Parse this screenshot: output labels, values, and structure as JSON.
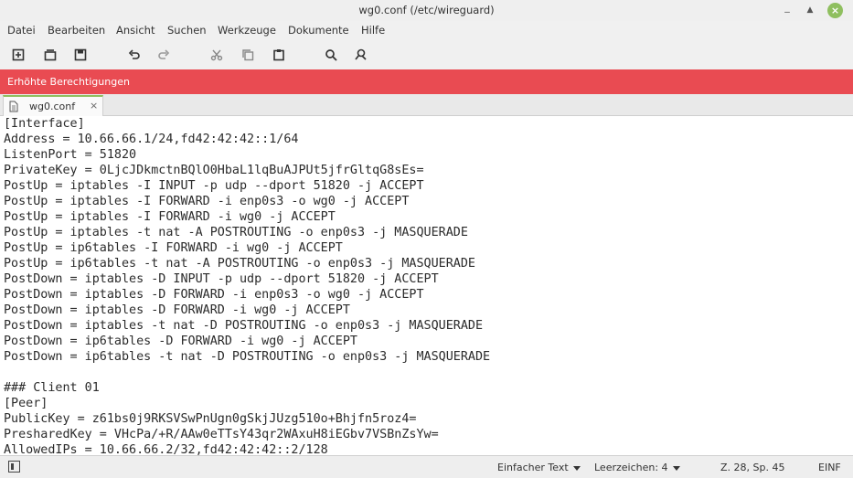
{
  "window": {
    "title": "wg0.conf (/etc/wireguard)"
  },
  "menu": {
    "items": [
      "Datei",
      "Bearbeiten",
      "Ansicht",
      "Suchen",
      "Werkzeuge",
      "Dokumente",
      "Hilfe"
    ]
  },
  "toolbar": {
    "buttons": [
      "new-document-icon",
      "open-icon",
      "save-icon",
      "undo-icon",
      "redo-icon",
      "cut-icon",
      "copy-icon",
      "paste-icon",
      "search-icon",
      "search-replace-icon"
    ]
  },
  "warning": {
    "text": "Erhöhte Berechtigungen",
    "color": "#e94b52"
  },
  "tabs": [
    {
      "label": "wg0.conf",
      "active": true
    }
  ],
  "editor": {
    "lines": [
      "[Interface]",
      "Address = 10.66.66.1/24,fd42:42:42::1/64",
      "ListenPort = 51820",
      "PrivateKey = 0LjcJDkmctnBQlO0HbaL1lqBuAJPUt5jfrGltqG8sEs=",
      "PostUp = iptables -I INPUT -p udp --dport 51820 -j ACCEPT",
      "PostUp = iptables -I FORWARD -i enp0s3 -o wg0 -j ACCEPT",
      "PostUp = iptables -I FORWARD -i wg0 -j ACCEPT",
      "PostUp = iptables -t nat -A POSTROUTING -o enp0s3 -j MASQUERADE",
      "PostUp = ip6tables -I FORWARD -i wg0 -j ACCEPT",
      "PostUp = ip6tables -t nat -A POSTROUTING -o enp0s3 -j MASQUERADE",
      "PostDown = iptables -D INPUT -p udp --dport 51820 -j ACCEPT",
      "PostDown = iptables -D FORWARD -i enp0s3 -o wg0 -j ACCEPT",
      "PostDown = iptables -D FORWARD -i wg0 -j ACCEPT",
      "PostDown = iptables -t nat -D POSTROUTING -o enp0s3 -j MASQUERADE",
      "PostDown = ip6tables -D FORWARD -i wg0 -j ACCEPT",
      "PostDown = ip6tables -t nat -D POSTROUTING -o enp0s3 -j MASQUERADE",
      "",
      "### Client 01",
      "[Peer]",
      "PublicKey = z61bs0j9RKSVSwPnUgn0gSkjJUzg510o+Bhjfn5roz4=",
      "PresharedKey = VHcPa/+R/AAw0eTTsY43qr2WAxuH8iEGbv7VSBnZsYw=",
      "AllowedIPs = 10.66.66.2/32,fd42:42:42::2/128"
    ]
  },
  "status": {
    "language": "Einfacher Text",
    "indent": "Leerzeichen: 4",
    "position": "Z. 28, Sp. 45",
    "mode": "EINF"
  }
}
